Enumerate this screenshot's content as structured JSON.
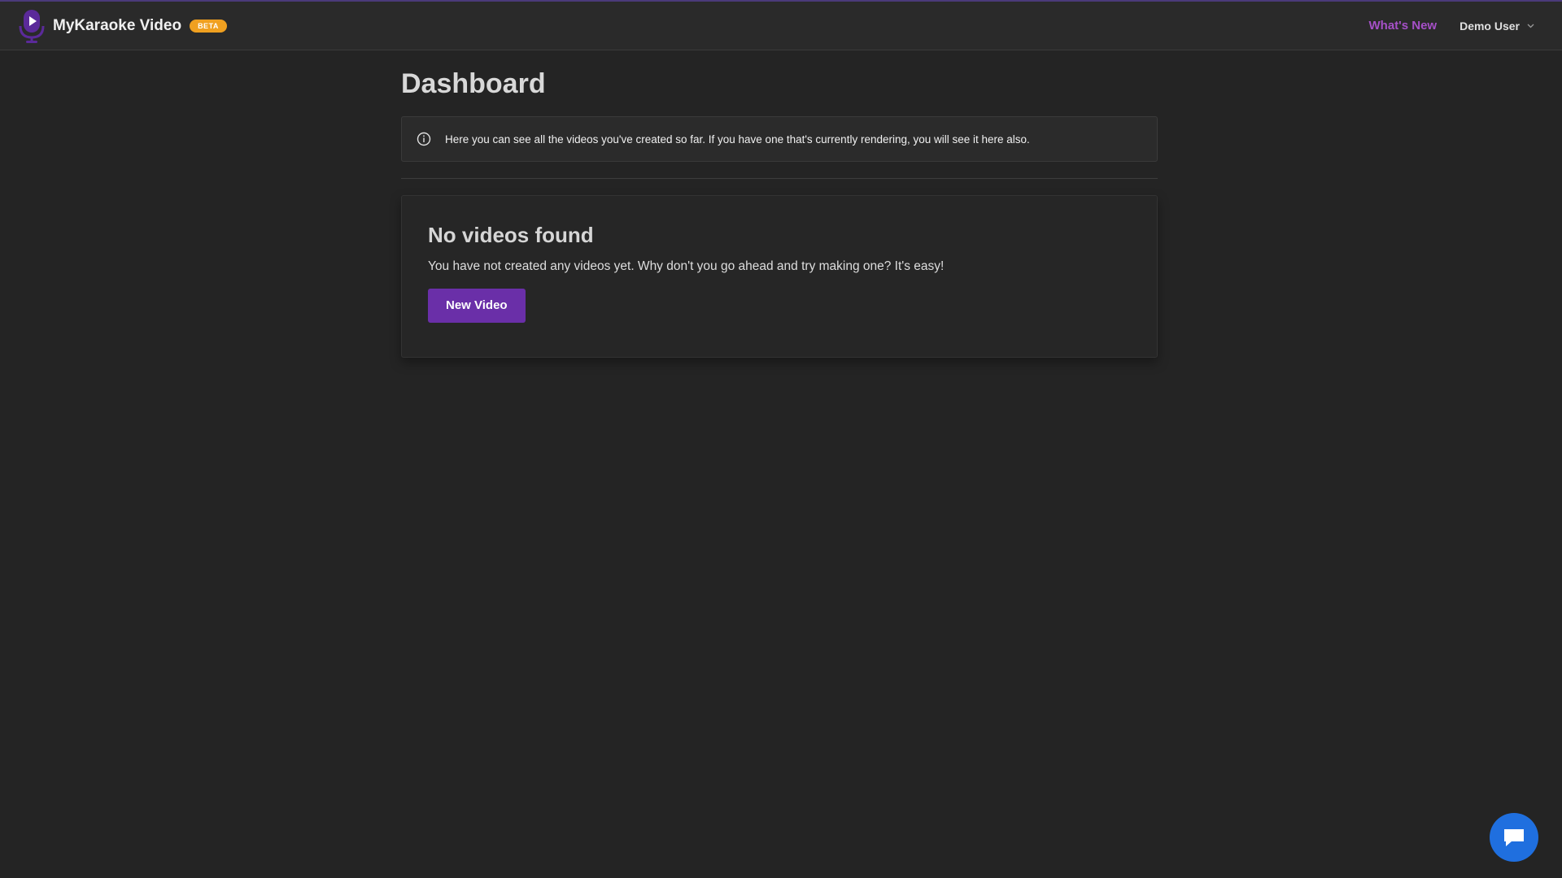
{
  "header": {
    "app_name": "MyKaraoke Video",
    "beta_badge": "BETA",
    "whats_new": "What's New",
    "user_name": "Demo User"
  },
  "page": {
    "title": "Dashboard",
    "info_text": "Here you can see all the videos you've created so far. If you have one that's currently rendering, you will see it here also."
  },
  "empty_state": {
    "title": "No videos found",
    "description": "You have not created any videos yet. Why don't you go ahead and try making one? It's easy!",
    "button_label": "New Video"
  },
  "icons": {
    "logo": "microphone-play-logo",
    "info": "info-icon",
    "dropdown": "chevron-down-icon",
    "chat": "chat-bubble-icon"
  },
  "colors": {
    "accent": "#6a2fa8",
    "link": "#a650c8",
    "beta": "#f0a020",
    "chat": "#1f6fdf",
    "background": "#242424"
  }
}
